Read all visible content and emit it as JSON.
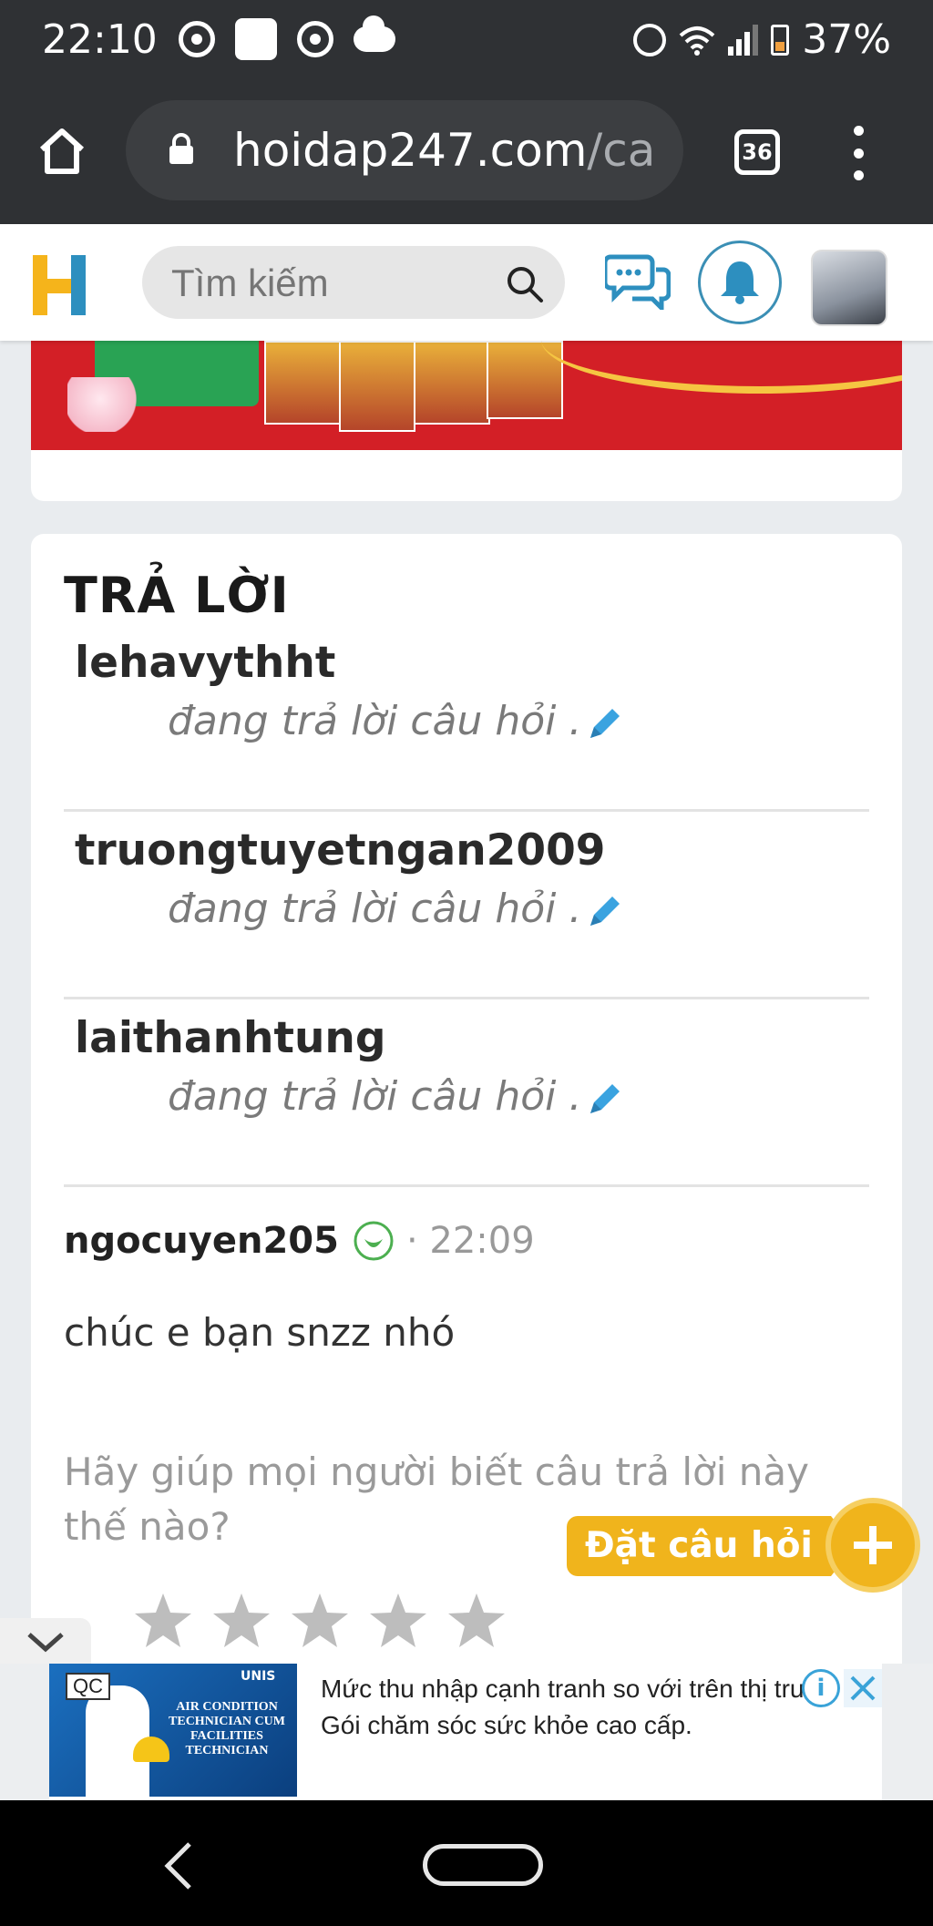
{
  "status_bar": {
    "time": "22:10",
    "battery": "37%"
  },
  "browser": {
    "url_domain": "hoidap247.com",
    "url_rest": "/ca",
    "tab_count": "36"
  },
  "header": {
    "search_placeholder": "Tìm kiếm"
  },
  "answers": {
    "title": "TRẢ LỜI",
    "typing": [
      {
        "user": "lehavythht",
        "status": "đang trả lời câu hỏi ."
      },
      {
        "user": "truongtuyetngan2009",
        "status": "đang trả lời câu hỏi ."
      },
      {
        "user": "laithanhtung",
        "status": "đang trả lời câu hỏi ."
      }
    ],
    "answer": {
      "author": "ngocuyen205",
      "time": "22:09",
      "body": "chúc e bạn snzz nhó"
    },
    "rate_prompt": "Hãy giúp mọi người biết câu trả lời này thế nào?",
    "rating": 0
  },
  "ask_button": {
    "label": "Đặt câu hỏi"
  },
  "ad": {
    "label": "QC",
    "image_text": "AIR CONDITION TECHNICIAN CUM FACILITIES TECHNICIAN",
    "brand": "UNIS",
    "line1": "Mức thu nhập cạnh tranh so với trên thị trư",
    "line2": "Gói chăm sóc sức khỏe cao cấp."
  },
  "colors": {
    "accent_yellow": "#f0b41c",
    "brand_blue": "#3b8fb5",
    "star_gray": "#bdbdbd"
  }
}
